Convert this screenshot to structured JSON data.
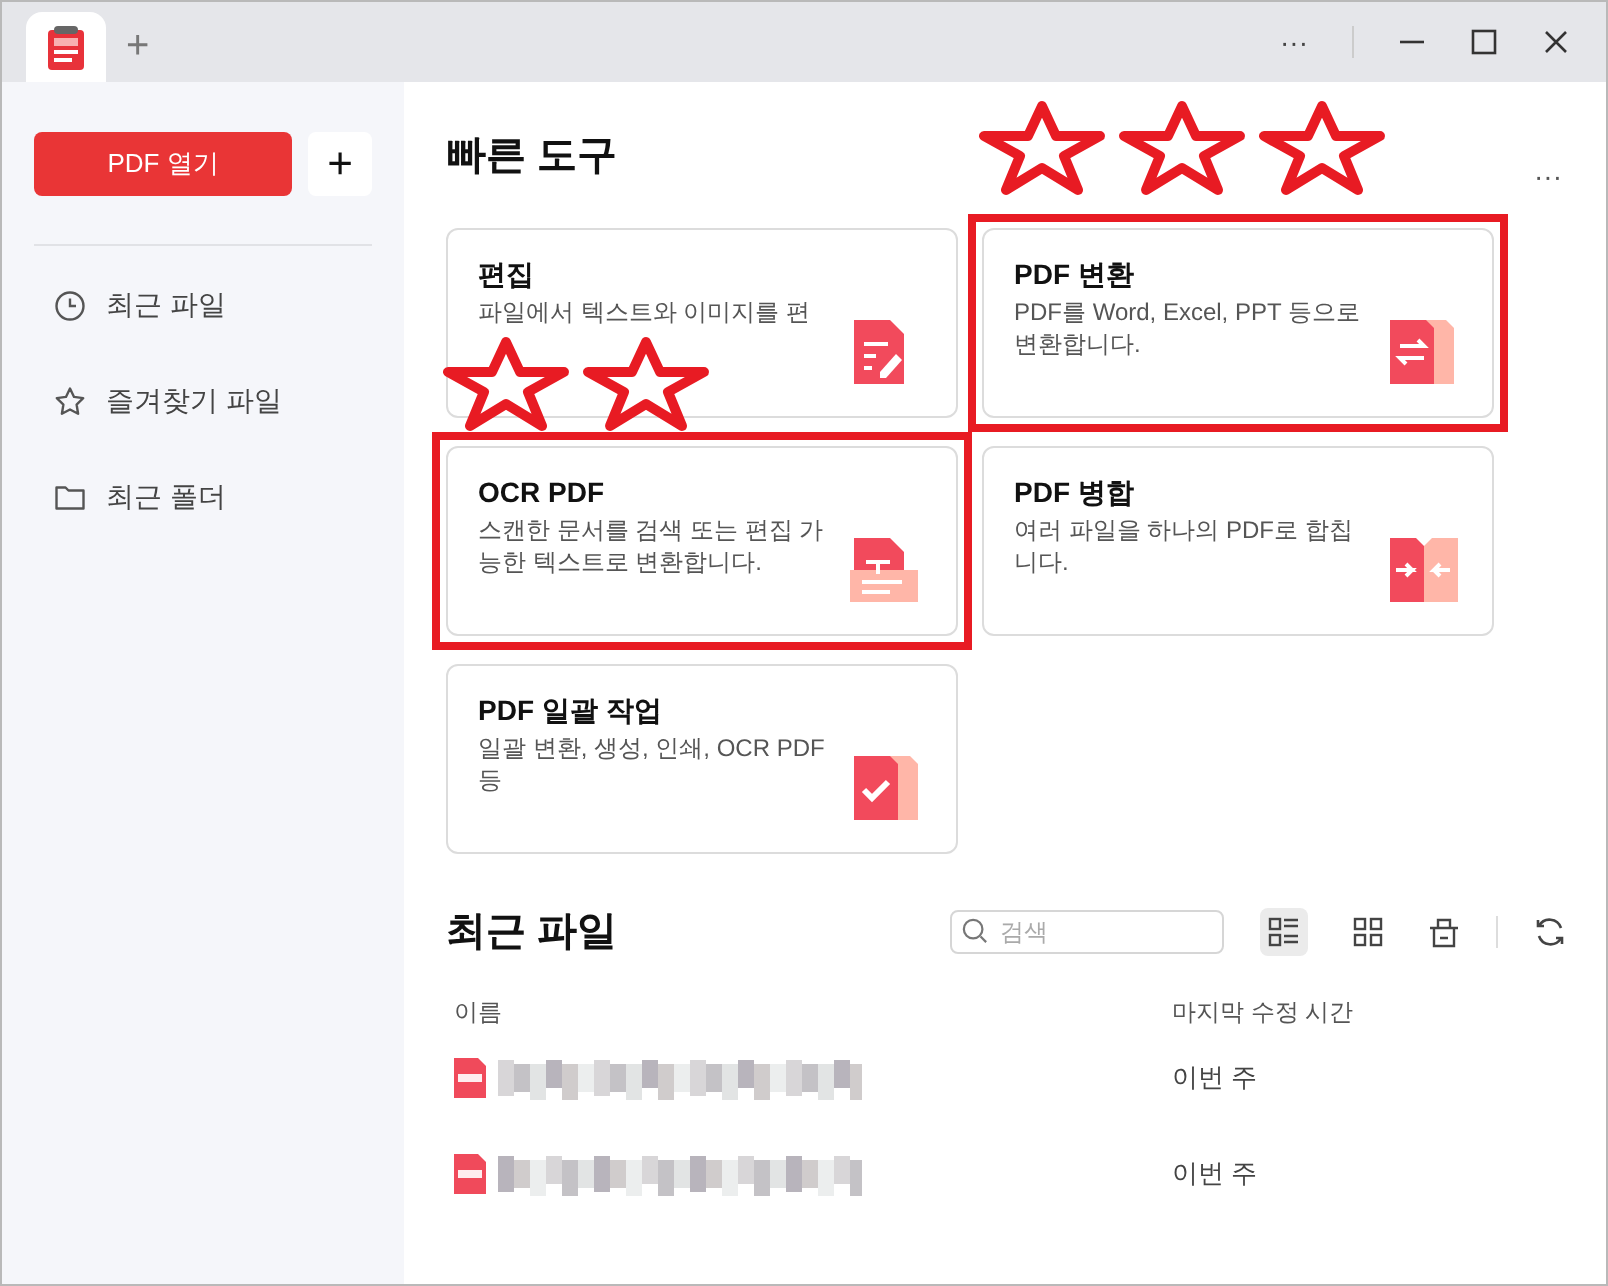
{
  "tabs": [
    {
      "kind": "app",
      "selected": true
    },
    {
      "kind": "new",
      "label": "+",
      "selected": false
    }
  ],
  "window_controls": {
    "more": "···"
  },
  "sidebar": {
    "open_button": "PDF 열기",
    "add_button": "+",
    "items": [
      {
        "label": "최근 파일"
      },
      {
        "label": "즐겨찾기 파일"
      },
      {
        "label": "최근 폴더"
      }
    ]
  },
  "quick_tools": {
    "title": "빠른 도구",
    "more": "···",
    "cards": [
      {
        "title": "편집",
        "description": "파일에서 텍스트와 이미지를 편",
        "highlighted": false
      },
      {
        "title": "PDF 변환",
        "description": "PDF를 Word, Excel, PPT 등으로 변환합니다.",
        "highlighted": true
      },
      {
        "title": "OCR PDF",
        "description": "스캔한 문서를 검색 또는 편집 가능한 텍스트로 변환합니다.",
        "highlighted": true
      },
      {
        "title": "PDF 병합",
        "description": "여러 파일을 하나의 PDF로 합칩니다.",
        "highlighted": false
      },
      {
        "title": "PDF 일괄 작업",
        "description": "일괄 변환, 생성, 인쇄, OCR PDF 등",
        "highlighted": false
      }
    ]
  },
  "recent_files": {
    "title": "최근 파일",
    "search": {
      "placeholder": "검색"
    },
    "view_buttons": [
      {
        "kind": "list",
        "selected": true
      },
      {
        "kind": "grid",
        "selected": false
      }
    ],
    "columns": [
      "이름",
      "마지막 수정 시간"
    ],
    "rows": [
      {
        "modified": "이번 주"
      },
      {
        "modified": "이번 주"
      }
    ]
  }
}
